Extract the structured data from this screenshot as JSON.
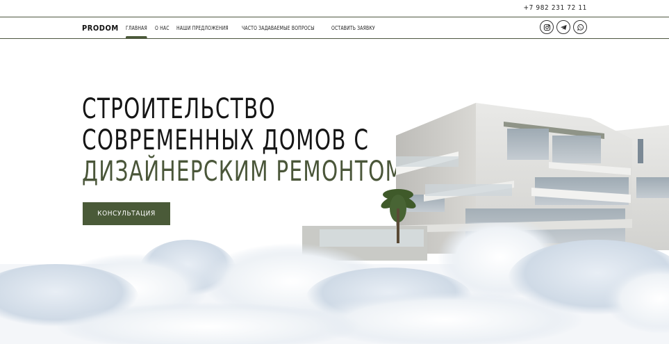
{
  "header": {
    "phone": "+7 982 231 72 11",
    "logo": "PRODOM",
    "nav": [
      {
        "label": "ГЛАВНАЯ",
        "active": true
      },
      {
        "label": "О НАС"
      },
      {
        "label": "НАШИ ПРЕДЛОЖЕНИЯ"
      },
      {
        "label": "ЧАСТО ЗАДАВАЕМЫЕ ВОПРОСЫ"
      },
      {
        "label": "ОСТАВИТЬ ЗАЯВКУ"
      }
    ],
    "socials": [
      "instagram-icon",
      "telegram-icon",
      "whatsapp-icon"
    ]
  },
  "hero": {
    "line1": "СТРОИТЕЛЬСТВО",
    "line2": "СОВРЕМЕННЫХ ДОМОВ С",
    "line3": "ДИЗАЙНЕРСКИМ РЕМОНТОМ",
    "cta": "КОНСУЛЬТАЦИЯ"
  },
  "colors": {
    "accent": "#4a5a38",
    "text": "#151515",
    "border": "#4d5640"
  }
}
